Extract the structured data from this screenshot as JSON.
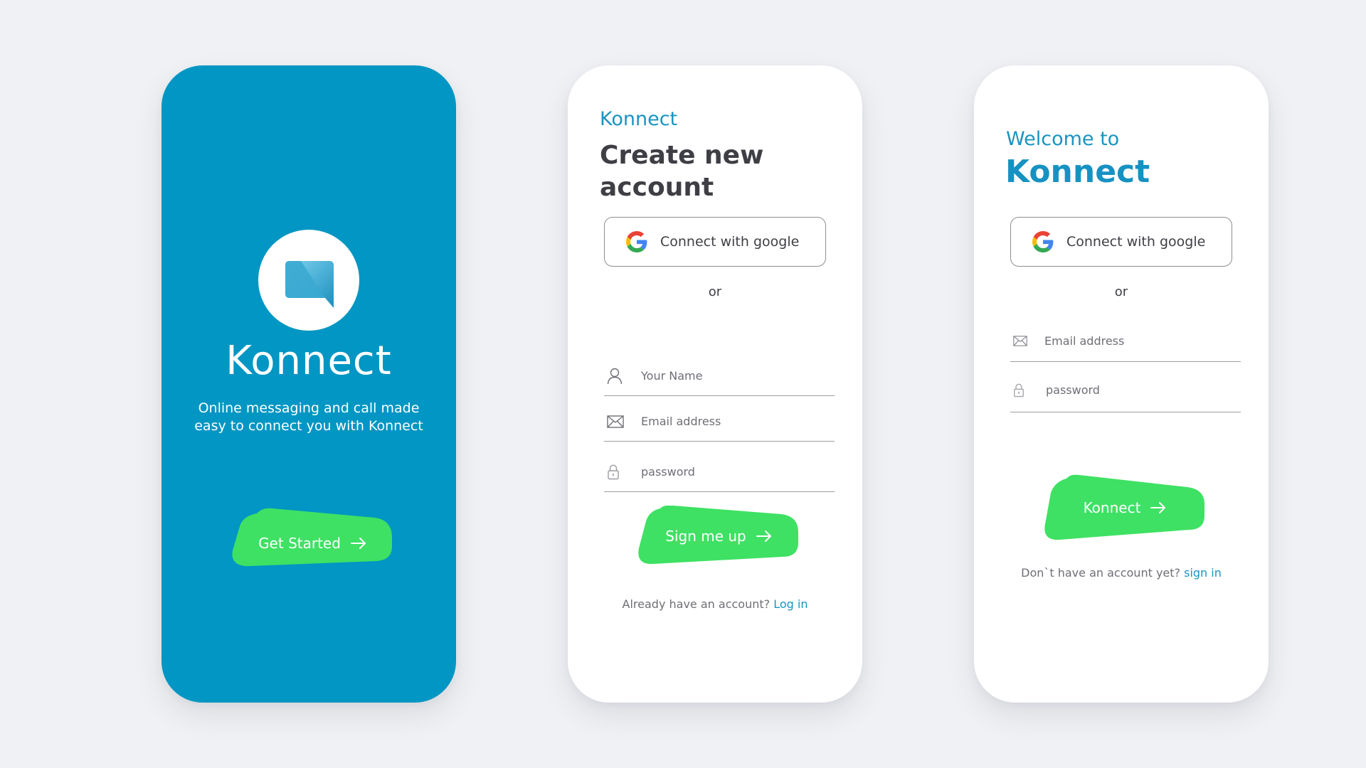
{
  "colors": {
    "brand_blue": "#0196c3",
    "accent_green": "#3ee163",
    "link_blue": "#1a94c0",
    "dark_text": "#3e3e45",
    "background": "#f0f1f4"
  },
  "splash": {
    "logo_icon": "chat-bubble-icon",
    "title": "Konnect",
    "tagline": "Online messaging and call made easy to connect you with Konnect",
    "cta_label": "Get Started",
    "cta_icon": "arrow-right-icon"
  },
  "signup": {
    "brand": "Konnect",
    "heading": "Create new account",
    "google_button": {
      "icon": "google-icon",
      "label": "Connect with google"
    },
    "divider": "or",
    "fields": [
      {
        "icon": "user-icon",
        "placeholder": "Your Name"
      },
      {
        "icon": "mail-icon",
        "placeholder": "Email address"
      },
      {
        "icon": "lock-icon",
        "placeholder": "password"
      }
    ],
    "submit_label": "Sign me up",
    "helper_text": "Already have an account?",
    "helper_link": "Log in"
  },
  "login": {
    "welcome": "Welcome to",
    "brand": "Konnect",
    "google_button": {
      "icon": "google-icon",
      "label": "Connect with google"
    },
    "divider": "or",
    "fields": [
      {
        "icon": "mail-icon",
        "placeholder": "Email address"
      },
      {
        "icon": "lock-icon",
        "placeholder": "password"
      }
    ],
    "submit_label": "Konnect",
    "helper_text": "Don`t have an account yet?",
    "helper_link": "sign in"
  }
}
